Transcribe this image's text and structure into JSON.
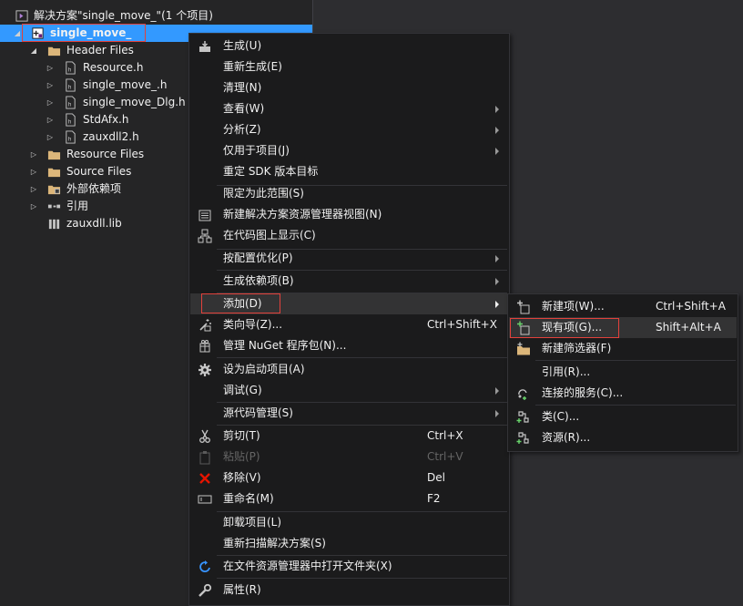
{
  "solution_explorer": {
    "solution_label": "解决方案\"single_move_\"(1 个项目)",
    "project_label": "single_move_",
    "tree": [
      {
        "label": "Header Files",
        "icon": "folder-icon"
      },
      {
        "label": "Resource.h",
        "icon": "header-file-icon"
      },
      {
        "label": "single_move_.h",
        "icon": "header-file-icon"
      },
      {
        "label": "single_move_Dlg.h",
        "icon": "header-file-icon"
      },
      {
        "label": "StdAfx.h",
        "icon": "header-file-icon"
      },
      {
        "label": "zauxdll2.h",
        "icon": "header-file-icon"
      },
      {
        "label": "Resource Files",
        "icon": "folder-icon"
      },
      {
        "label": "Source Files",
        "icon": "folder-icon"
      },
      {
        "label": "外部依赖项",
        "icon": "external-deps-icon"
      },
      {
        "label": "引用",
        "icon": "references-icon"
      },
      {
        "label": "zauxdll.lib",
        "icon": "lib-file-icon"
      }
    ]
  },
  "context_menu": {
    "items": [
      {
        "label": "生成(U)",
        "icon": "build-icon"
      },
      {
        "label": "重新生成(E)"
      },
      {
        "label": "清理(N)"
      },
      {
        "label": "查看(W)"
      },
      {
        "label": "分析(Z)"
      },
      {
        "label": "仅用于项目(J)"
      },
      {
        "label": "重定 SDK 版本目标"
      },
      {
        "label": "限定为此范围(S)"
      },
      {
        "label": "新建解决方案资源管理器视图(N)",
        "icon": "new-view-icon"
      },
      {
        "label": "在代码图上显示(C)",
        "icon": "code-map-icon"
      },
      {
        "label": "按配置优化(P)"
      },
      {
        "label": "生成依赖项(B)"
      },
      {
        "label": "添加(D)"
      },
      {
        "label": "类向导(Z)...",
        "shortcut": "Ctrl+Shift+X",
        "icon": "class-wizard-icon"
      },
      {
        "label": "管理 NuGet 程序包(N)...",
        "icon": "nuget-icon"
      },
      {
        "label": "设为启动项目(A)",
        "icon": "gear-icon"
      },
      {
        "label": "调试(G)"
      },
      {
        "label": "源代码管理(S)"
      },
      {
        "label": "剪切(T)",
        "shortcut": "Ctrl+X",
        "icon": "cut-icon"
      },
      {
        "label": "粘贴(P)",
        "shortcut": "Ctrl+V",
        "icon": "paste-icon"
      },
      {
        "label": "移除(V)",
        "shortcut": "Del",
        "icon": "remove-icon"
      },
      {
        "label": "重命名(M)",
        "shortcut": "F2",
        "icon": "rename-icon"
      },
      {
        "label": "卸载项目(L)"
      },
      {
        "label": "重新扫描解决方案(S)"
      },
      {
        "label": "在文件资源管理器中打开文件夹(X)",
        "icon": "open-folder-icon"
      },
      {
        "label": "属性(R)",
        "icon": "wrench-icon"
      }
    ]
  },
  "add_submenu": {
    "items": [
      {
        "label": "新建项(W)...",
        "shortcut": "Ctrl+Shift+A",
        "icon": "new-item-icon"
      },
      {
        "label": "现有项(G)...",
        "shortcut": "Shift+Alt+A",
        "icon": "existing-item-icon"
      },
      {
        "label": "新建筛选器(F)",
        "icon": "new-filter-icon"
      },
      {
        "label": "引用(R)..."
      },
      {
        "label": "连接的服务(C)...",
        "icon": "connected-service-icon"
      },
      {
        "label": "类(C)...",
        "icon": "class-icon"
      },
      {
        "label": "资源(R)...",
        "icon": "resource-icon"
      }
    ]
  },
  "colors": {
    "background": "#2d2d30",
    "explorer_bg": "#252526",
    "menu_bg": "#1b1b1c",
    "selection": "#3399ff",
    "highlight_box": "#e2413b"
  }
}
